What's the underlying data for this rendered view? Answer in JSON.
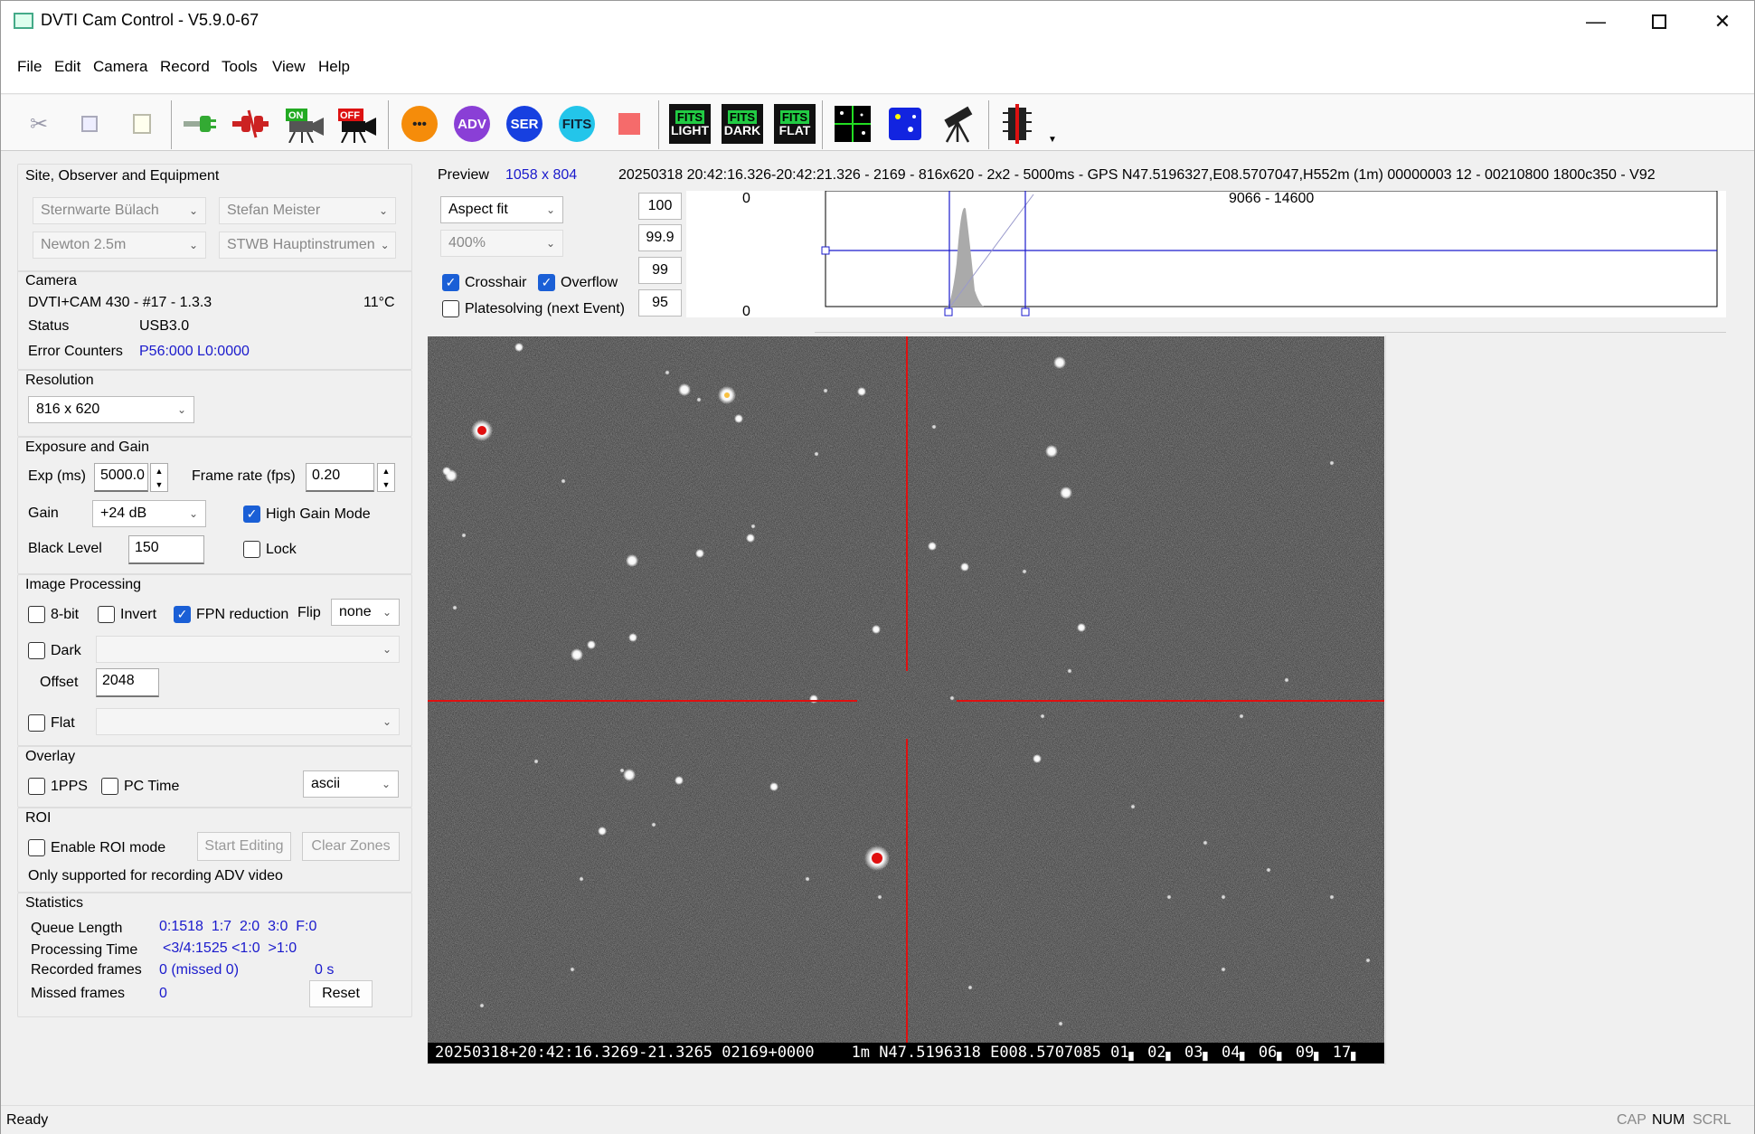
{
  "window": {
    "title": "DVTI Cam Control - V5.9.0-67"
  },
  "menu": [
    "File",
    "Edit",
    "Camera",
    "Record",
    "Tools",
    "View",
    "Help"
  ],
  "toolbar": {
    "on_label": "ON",
    "off_label": "OFF",
    "circles": [
      {
        "label": "•••",
        "color": "#f58c0a"
      },
      {
        "label": "ADV",
        "color": "#8a3fd6"
      },
      {
        "label": "SER",
        "color": "#1740e0"
      },
      {
        "label": "FITS",
        "color": "#23c5ea"
      }
    ],
    "fits": [
      {
        "top": "FITS",
        "bottom": "LIGHT"
      },
      {
        "top": "FITS",
        "bottom": "DARK"
      },
      {
        "top": "FITS",
        "bottom": "FLAT"
      }
    ]
  },
  "site": {
    "title": "Site, Observer and Equipment",
    "observatory": "Sternwarte Bülach",
    "observer": "Stefan Meister",
    "telescope": "Newton 2.5m",
    "instrument": "STWB Hauptinstrumen"
  },
  "camera": {
    "title": "Camera",
    "model": "DVTI+CAM 430  -  #17  -  1.3.3",
    "temp": "11°C",
    "status_label": "Status",
    "status_value": "USB3.0",
    "errors_label": "Error Counters",
    "errors_value": "P56:000 L0:0000"
  },
  "resolution": {
    "title": "Resolution",
    "value": "816 x 620"
  },
  "exposure": {
    "title": "Exposure and Gain",
    "exp_label": "Exp (ms)",
    "exp_value": "5000.0",
    "fps_label": "Frame rate (fps)",
    "fps_value": "0.20",
    "gain_label": "Gain",
    "gain_value": "+24 dB",
    "high_gain": "High Gain Mode",
    "black_label": "Black Level",
    "black_value": "150",
    "lock": "Lock"
  },
  "processing": {
    "title": "Image Processing",
    "bit8": "8-bit",
    "invert": "Invert",
    "fpn": "FPN reduction",
    "flip_label": "Flip",
    "flip_value": "none",
    "dark": "Dark",
    "offset_label": "Offset",
    "offset_value": "2048",
    "flat": "Flat"
  },
  "overlay": {
    "title": "Overlay",
    "pps": "1PPS",
    "pctime": "PC Time",
    "format": "ascii"
  },
  "roi": {
    "title": "ROI",
    "enable": "Enable ROI mode",
    "start": "Start Editing",
    "clear": "Clear Zones",
    "note": "Only supported for recording ADV video"
  },
  "stats": {
    "title": "Statistics",
    "queue_label": "Queue Length",
    "queue_value": "0:1518  1:7  2:0  3:0  F:0",
    "proc_label": "Processing Time",
    "proc_value": "<3/4:1525 <1:0  >1:0",
    "rec_label": "Recorded frames",
    "rec_value": "0 (missed 0)",
    "rec_time": "0 s",
    "missed_label": "Missed frames",
    "missed_value": "0",
    "reset": "Reset"
  },
  "preview": {
    "label": "Preview",
    "size": "1058 x 804",
    "info": "20250318 20:42:16.326-20:42:21.326 - 2169 - 816x620 - 2x2 - 5000ms - GPS N47.5196327,E08.5707047,H552m (1m) 00000003 12 - 00210800 1800c350 - V92",
    "fit": "Aspect fit",
    "zoom": "400%",
    "crosshair": "Crosshair",
    "overflow": "Overflow",
    "platesolve": "Platesolving (next Event)",
    "levels": [
      "100",
      "99.9",
      "99",
      "95"
    ],
    "hist_top": "0",
    "hist_bottom": "0",
    "hist_range": "9066 - 14600"
  },
  "image": {
    "overlay_text": "20250318+20:42:16.3269-21.3265 02169+0000    1m N47.5196318 E008.5707085 01▖ 02▖ 03▖ 04▖ 06▖ 09▖ 17▖"
  },
  "statusbar": {
    "ready": "Ready",
    "cap": "CAP",
    "num": "NUM",
    "scrl": "SCRL"
  }
}
